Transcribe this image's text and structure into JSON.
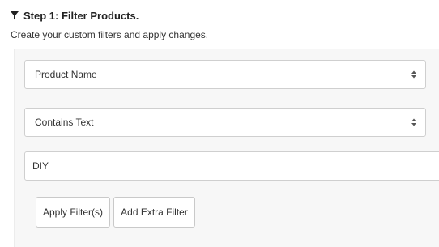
{
  "header": {
    "icon": "funnel-icon",
    "title": "Step 1: Filter Products.",
    "subtitle": "Create your custom filters and apply changes."
  },
  "filter": {
    "field_select": {
      "selected": "Product Name",
      "icon": "chevron-up-down-icon"
    },
    "operator_select": {
      "selected": "Contains Text",
      "icon": "chevron-up-down-icon"
    },
    "value_input": {
      "value": "DIY"
    }
  },
  "actions": {
    "apply_label": "Apply Filter(s)",
    "add_label": "Add Extra Filter"
  },
  "colors": {
    "panel_background": "#f7f7f7",
    "border": "#cfcfcf"
  }
}
